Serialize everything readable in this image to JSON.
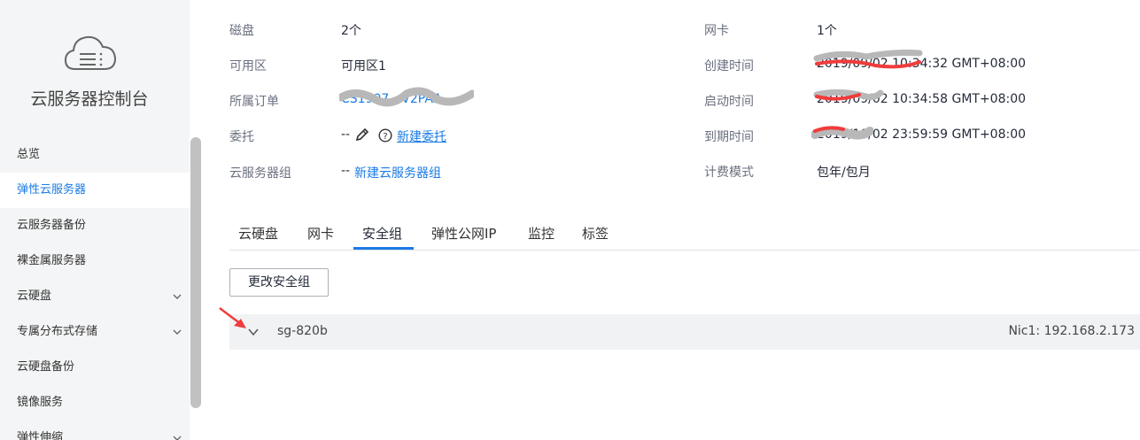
{
  "sidebar": {
    "title": "云服务器控制台",
    "items": [
      {
        "label": "总览",
        "active": false,
        "expandable": false
      },
      {
        "label": "弹性云服务器",
        "active": true,
        "expandable": false
      },
      {
        "label": "云服务器备份",
        "active": false,
        "expandable": false
      },
      {
        "label": "裸金属服务器",
        "active": false,
        "expandable": false
      },
      {
        "label": "云硬盘",
        "active": false,
        "expandable": true
      },
      {
        "label": "专属分布式存储",
        "active": false,
        "expandable": true
      },
      {
        "label": "云硬盘备份",
        "active": false,
        "expandable": false
      },
      {
        "label": "镜像服务",
        "active": false,
        "expandable": false
      },
      {
        "label": "弹性伸缩",
        "active": false,
        "expandable": true
      }
    ]
  },
  "info": {
    "disk": {
      "label": "磁盘",
      "value": "2个"
    },
    "az": {
      "label": "可用区",
      "value": "可用区1"
    },
    "order": {
      "label": "所属订单",
      "value": "CS1907…V2PAA"
    },
    "delegation": {
      "label": "委托",
      "value": "--",
      "link": "新建委托"
    },
    "server_group": {
      "label": "云服务器组",
      "value": "--",
      "link": "新建云服务器组"
    },
    "nic": {
      "label": "网卡",
      "value": "1个"
    },
    "created": {
      "label": "创建时间",
      "value": "2019/09/02 10:34:32 GMT+08:00"
    },
    "started": {
      "label": "启动时间",
      "value": "2019/09/02 10:34:58 GMT+08:00"
    },
    "expires": {
      "label": "到期时间",
      "value": "2019/10/02 23:59:59 GMT+08:00"
    },
    "billing": {
      "label": "计费模式",
      "value": "包年/包月"
    }
  },
  "tabs": [
    {
      "label": "云硬盘",
      "active": false
    },
    {
      "label": "网卡",
      "active": false
    },
    {
      "label": "安全组",
      "active": true
    },
    {
      "label": "弹性公网IP",
      "active": false
    },
    {
      "label": "监控",
      "active": false
    },
    {
      "label": "标签",
      "active": false
    }
  ],
  "actions": {
    "change_sg": "更改安全组"
  },
  "security_group": {
    "name": "sg-820b",
    "nic": "Nic1: 192.168.2.173"
  },
  "colors": {
    "accent": "#1a7be6",
    "annotation_red": "#f03c3c",
    "redaction_gray": "#b8b8b8"
  }
}
